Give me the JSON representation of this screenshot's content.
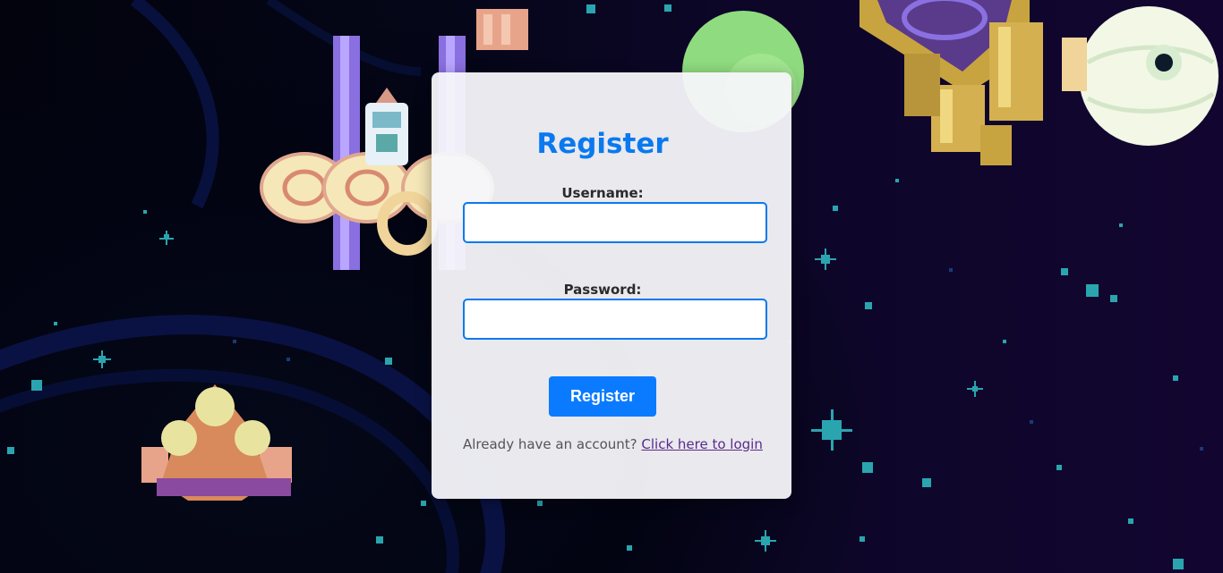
{
  "form": {
    "title": "Register",
    "username_label": "Username:",
    "username_value": "",
    "password_label": "Password:",
    "password_value": "",
    "submit_label": "Register",
    "footer_text": "Already have an account? ",
    "login_link_text": "Click here to login"
  },
  "colors": {
    "accent": "#0a79f0",
    "button": "#0a7bff",
    "link_visited": "#5a2a8a",
    "background": "#0d0628"
  }
}
